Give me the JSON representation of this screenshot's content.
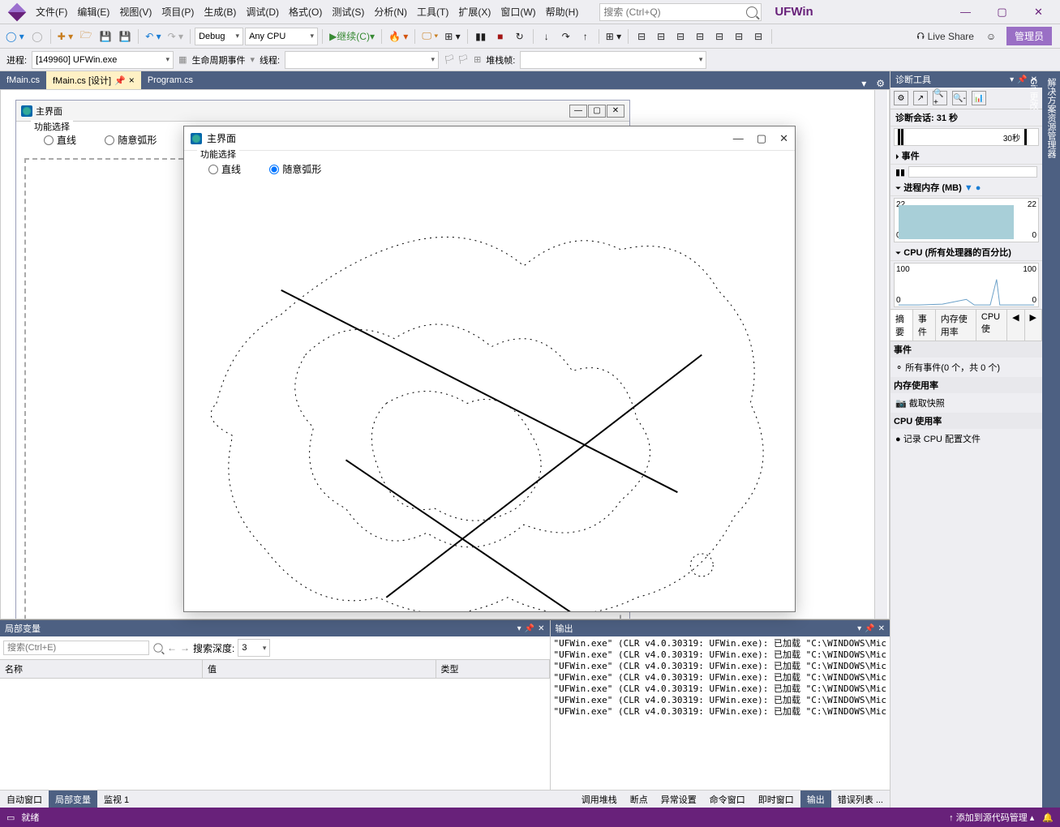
{
  "title": "UFWin",
  "menu": [
    "文件(F)",
    "编辑(E)",
    "视图(V)",
    "项目(P)",
    "生成(B)",
    "调试(D)",
    "格式(O)",
    "测试(S)",
    "分析(N)",
    "工具(T)",
    "扩展(X)",
    "窗口(W)",
    "帮助(H)"
  ],
  "search": {
    "placeholder": "搜索 (Ctrl+Q)"
  },
  "toolbar": {
    "config": "Debug",
    "platform": "Any CPU",
    "continue": "继续(C)",
    "liveshare": "Live Share",
    "admin": "管理员"
  },
  "debugbar": {
    "process_label": "进程:",
    "process_value": "[149960] UFWin.exe",
    "lifecycle": "生命周期事件",
    "thread_label": "线程:",
    "stackframe_label": "堆栈帧:"
  },
  "tabs": [
    {
      "label": "fMain.cs",
      "active": false
    },
    {
      "label": "fMain.cs [设计]",
      "active": true,
      "pinned": true
    },
    {
      "label": "Program.cs",
      "active": false
    }
  ],
  "design_form": {
    "title": "主界面",
    "group": "功能选择",
    "radio1": "直线",
    "radio2": "随意弧形"
  },
  "runtime_window": {
    "title": "主界面",
    "group": "功能选择",
    "radio1": "直线",
    "radio2": "随意弧形",
    "radio2_checked": true
  },
  "diag": {
    "header": "诊断工具",
    "session": "诊断会话: 31 秒",
    "time_30s": "30秒",
    "events": "事件",
    "mem_title": "进程内存 (MB)",
    "mem_max": "22",
    "mem_min": "0",
    "cpu_title": "CPU (所有处理器的百分比)",
    "cpu_max": "100",
    "cpu_min": "0",
    "tabs": [
      "摘要",
      "事件",
      "内存使用率",
      "CPU 使"
    ],
    "sec_events": "事件",
    "all_events": "所有事件(0 个，共 0 个)",
    "sec_mem": "内存使用率",
    "snapshot": "截取快照",
    "sec_cpu": "CPU 使用率",
    "record_cpu": "记录 CPU 配置文件"
  },
  "side_tabs": [
    "解决方案资源管理器",
    "Git 更改"
  ],
  "locals": {
    "header": "局部变量",
    "search_placeholder": "搜索(Ctrl+E)",
    "depth_label": "搜索深度:",
    "depth_value": "3",
    "col_name": "名称",
    "col_value": "值",
    "col_type": "类型"
  },
  "output": {
    "header": "输出",
    "lines": [
      "\"UFWin.exe\" (CLR v4.0.30319: UFWin.exe): 已加载 \"C:\\WINDOWS\\Mic",
      "\"UFWin.exe\" (CLR v4.0.30319: UFWin.exe): 已加载 \"C:\\WINDOWS\\Mic",
      "\"UFWin.exe\" (CLR v4.0.30319: UFWin.exe): 已加载 \"C:\\WINDOWS\\Mic",
      "\"UFWin.exe\" (CLR v4.0.30319: UFWin.exe): 已加载 \"C:\\WINDOWS\\Mic",
      "\"UFWin.exe\" (CLR v4.0.30319: UFWin.exe): 已加载 \"C:\\WINDOWS\\Mic",
      "\"UFWin.exe\" (CLR v4.0.30319: UFWin.exe): 已加载 \"C:\\WINDOWS\\Mic",
      "\"UFWin.exe\" (CLR v4.0.30319: UFWin.exe): 已加载 \"C:\\WINDOWS\\Mic"
    ]
  },
  "bottom_tabs_left": [
    "自动窗口",
    "局部变量",
    "监视 1"
  ],
  "bottom_tabs_right": [
    "调用堆栈",
    "断点",
    "异常设置",
    "命令窗口",
    "即时窗口",
    "输出",
    "错误列表 ..."
  ],
  "status": {
    "ready": "就绪",
    "add_source": "添加到源代码管理"
  }
}
